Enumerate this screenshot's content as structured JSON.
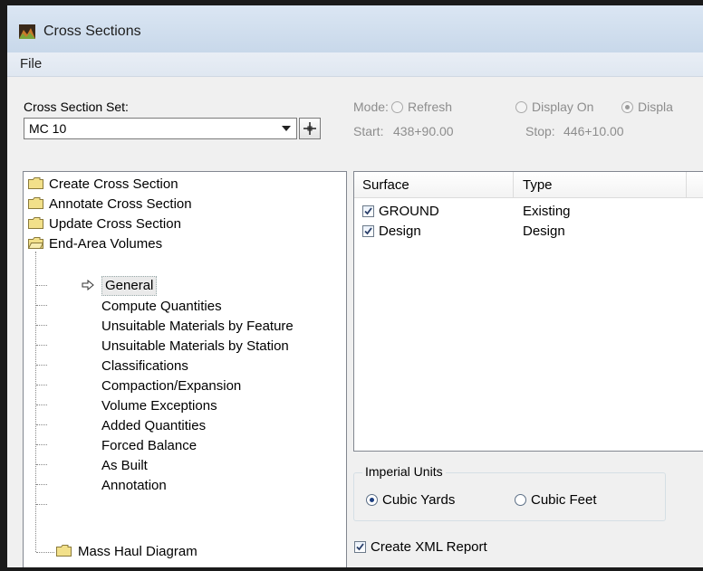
{
  "window": {
    "title": "Cross Sections"
  },
  "menu": {
    "file": "File"
  },
  "cross_section_set": {
    "label": "Cross Section Set:",
    "value": "MC 10"
  },
  "mode": {
    "label": "Mode:",
    "options": [
      "Refresh",
      "Display On",
      "Displa"
    ],
    "selected": "Displa"
  },
  "range": {
    "start_label": "Start:",
    "start_value": "438+90.00",
    "stop_label": "Stop:",
    "stop_value": "446+10.00"
  },
  "tree": {
    "folders": [
      "Create Cross Section",
      "Annotate Cross Section",
      "Update Cross Section",
      "End-Area Volumes"
    ],
    "children": [
      "General",
      "Compute Quantities",
      "Unsuitable Materials by Feature",
      "Unsuitable Materials by Station",
      "Classifications",
      "Compaction/Expansion",
      "Volume Exceptions",
      "Added Quantities",
      "Forced Balance",
      "As Built",
      "Annotation"
    ],
    "last_folder": "Mass Haul Diagram",
    "selected": "General"
  },
  "surfaces": {
    "headers": [
      "Surface",
      "Type"
    ],
    "rows": [
      {
        "surface": "GROUND",
        "type": "Existing",
        "checked": true
      },
      {
        "surface": "Design",
        "type": "Design",
        "checked": true
      }
    ]
  },
  "units": {
    "group_label": "Imperial Units",
    "options": [
      "Cubic Yards",
      "Cubic Feet"
    ],
    "selected": "Cubic Yards"
  },
  "xml_report": {
    "label": "Create XML Report",
    "checked": true
  }
}
